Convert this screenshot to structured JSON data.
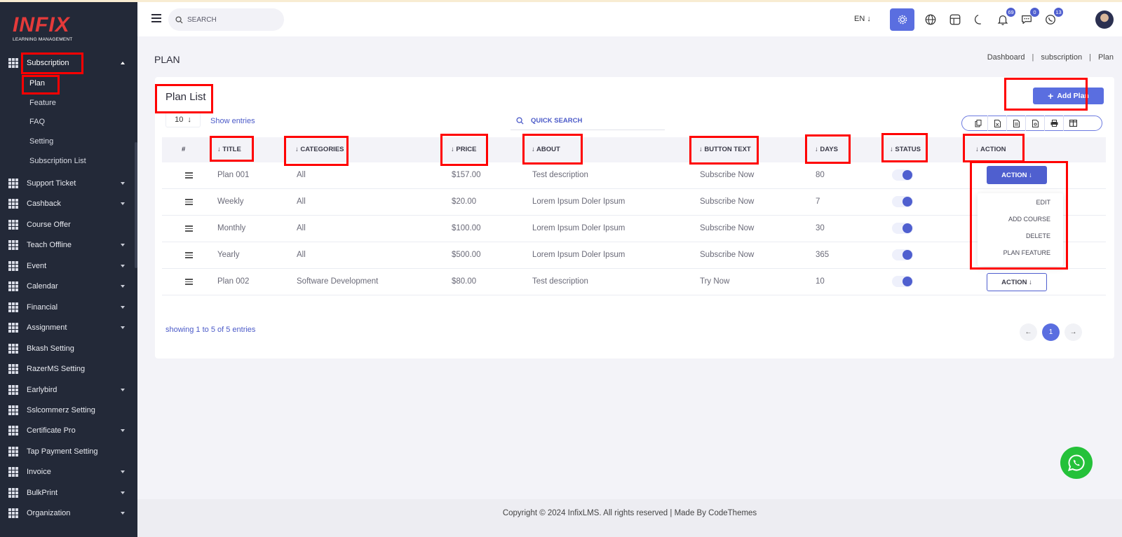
{
  "logo": {
    "main": "INFIX",
    "sub": "LEARNING MANAGEMENT"
  },
  "sidebar": {
    "active_group": "Subscription",
    "subitems": [
      "Plan",
      "Feature",
      "FAQ",
      "Setting",
      "Subscription List"
    ],
    "items": [
      {
        "label": "Support Ticket",
        "caret": true
      },
      {
        "label": "Cashback",
        "caret": true
      },
      {
        "label": "Course Offer",
        "caret": false
      },
      {
        "label": "Teach Offline",
        "caret": true
      },
      {
        "label": "Event",
        "caret": true
      },
      {
        "label": "Calendar",
        "caret": true
      },
      {
        "label": "Financial",
        "caret": true
      },
      {
        "label": "Assignment",
        "caret": true
      },
      {
        "label": "Bkash Setting",
        "caret": false
      },
      {
        "label": "RazerMS Setting",
        "caret": false
      },
      {
        "label": "Earlybird",
        "caret": true
      },
      {
        "label": "Sslcommerz Setting",
        "caret": false
      },
      {
        "label": "Certificate Pro",
        "caret": true
      },
      {
        "label": "Tap Payment Setting",
        "caret": false
      },
      {
        "label": "Invoice",
        "caret": true
      },
      {
        "label": "BulkPrint",
        "caret": true
      },
      {
        "label": "Organization",
        "caret": true
      }
    ]
  },
  "header": {
    "search_placeholder": "SEARCH",
    "lang": "EN",
    "badges": {
      "notifications": "69",
      "messages": "0",
      "whatsapp": "13"
    }
  },
  "page": {
    "title": "PLAN",
    "breadcrumb": [
      "Dashboard",
      "subscription",
      "Plan"
    ],
    "breadcrumb_sep": "|"
  },
  "card": {
    "title": "Plan List",
    "add_button": "Add Plan",
    "entries_value": "10",
    "show_entries": "Show entries",
    "quick_search": "QUICK SEARCH",
    "showing": "showing 1 to 5 of 5 entries",
    "current_page": "1"
  },
  "table": {
    "headers": [
      "#",
      "TITLE",
      "CATEGORIES",
      "PRICE",
      "ABOUT",
      "BUTTON TEXT",
      "DAYS",
      "STATUS",
      "ACTION"
    ],
    "rows": [
      {
        "title": "Plan 001",
        "categories": "All",
        "price": "$157.00",
        "about": "Test description",
        "button_text": "Subscribe Now",
        "days": "80",
        "status": true
      },
      {
        "title": "Weekly",
        "categories": "All",
        "price": "$20.00",
        "about": "Lorem Ipsum Doler Ipsum",
        "button_text": "Subscribe Now",
        "days": "7",
        "status": true
      },
      {
        "title": "Monthly",
        "categories": "All",
        "price": "$100.00",
        "about": "Lorem Ipsum Doler Ipsum",
        "button_text": "Subscribe Now",
        "days": "30",
        "status": true
      },
      {
        "title": "Yearly",
        "categories": "All",
        "price": "$500.00",
        "about": "Lorem Ipsum Doler Ipsum",
        "button_text": "Subscribe Now",
        "days": "365",
        "status": true
      },
      {
        "title": "Plan 002",
        "categories": "Software Development",
        "price": "$80.00",
        "about": "Test description",
        "button_text": "Try Now",
        "days": "10",
        "status": true
      }
    ],
    "action_label": "ACTION",
    "dropdown": [
      "EDIT",
      "ADD COURSE",
      "DELETE",
      "PLAN FEATURE"
    ]
  },
  "footer": {
    "text": "Copyright © 2024 InfixLMS. All rights reserved | Made By CodeThemes"
  },
  "colors": {
    "accent": "#5a6ee0",
    "sidebar": "#232938",
    "highlight": "#ff0000",
    "whatsapp": "#25c13a"
  }
}
